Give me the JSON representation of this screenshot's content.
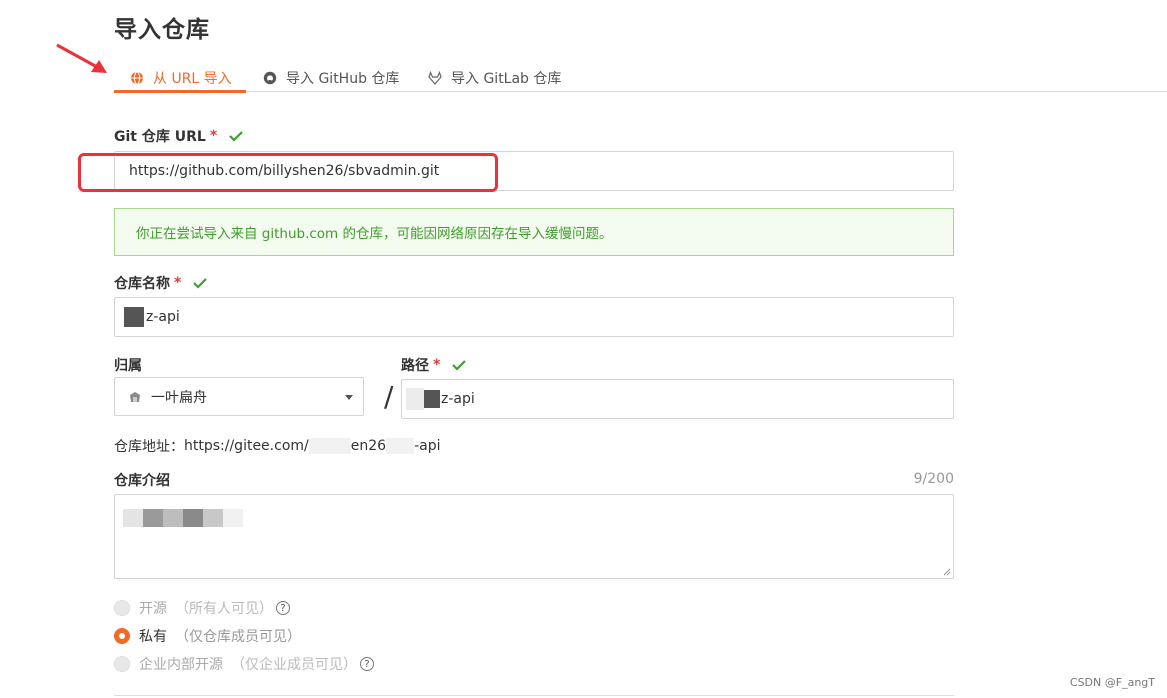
{
  "page": {
    "title": "导入仓库"
  },
  "tabs": [
    {
      "label": "从 URL 导入",
      "icon": "globe-icon",
      "active": true
    },
    {
      "label": "导入 GitHub 仓库",
      "icon": "github-icon",
      "active": false
    },
    {
      "label": "导入 GitLab 仓库",
      "icon": "gitlab-icon",
      "active": false
    }
  ],
  "git_url": {
    "label": "Git 仓库 URL",
    "required_mark": "*",
    "value": "https://github.com/billyshen26/sbvadmin.git",
    "notice": "你正在尝试导入来自 github.com 的仓库，可能因网络原因存在导入缓慢问题。"
  },
  "repo_name": {
    "label": "仓库名称",
    "required_mark": "*",
    "value": "z-api"
  },
  "owner": {
    "label": "归属",
    "value": "一叶扁舟"
  },
  "separator": "/",
  "path": {
    "label": "路径",
    "required_mark": "*",
    "value": "z-api"
  },
  "repo_address": {
    "label": "仓库地址：",
    "prefix": "https://gitee.com/",
    "middle": "en26",
    "suffix": "-api"
  },
  "description": {
    "label": "仓库介绍",
    "counter": "9/200"
  },
  "visibility": [
    {
      "label": "开源",
      "hint": "（所有人可见）",
      "selected": false,
      "disabled": true,
      "help": "?"
    },
    {
      "label": "私有",
      "hint": "（仅仓库成员可见）",
      "selected": true,
      "disabled": false
    },
    {
      "label": "企业内部开源",
      "hint": "（仅企业成员可见）",
      "selected": false,
      "disabled": true,
      "help": "?"
    }
  ],
  "watermark": "CSDN @F_angT",
  "colors": {
    "accent": "#f06a28",
    "success": "#3d9f2c",
    "required": "#e03a3a",
    "annotation": "#e9323a"
  }
}
